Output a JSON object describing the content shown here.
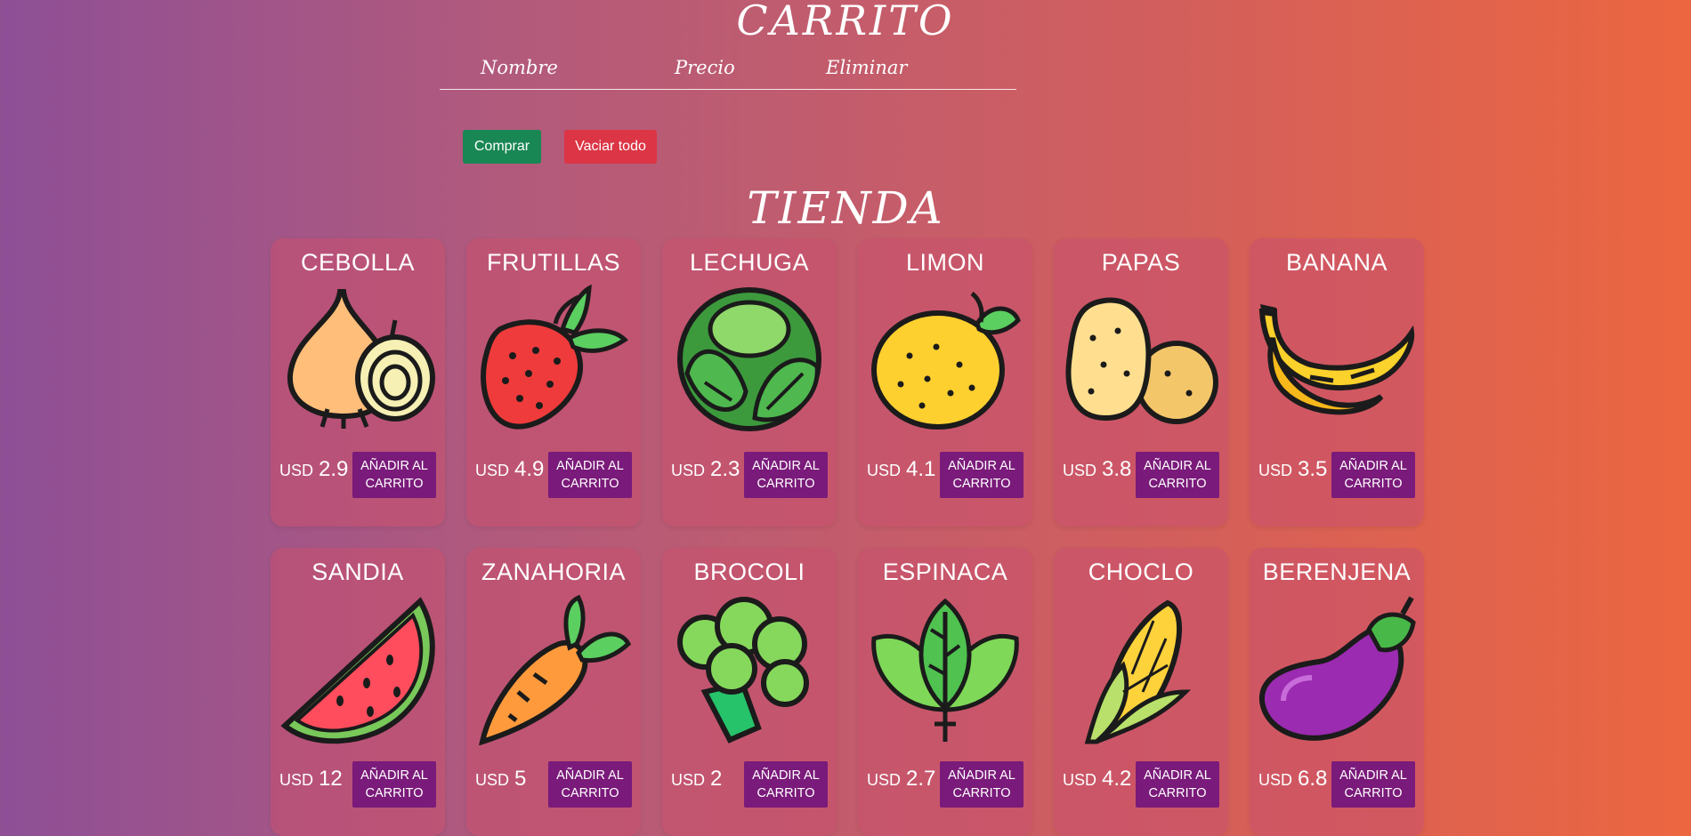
{
  "cart": {
    "title": "CARRITO",
    "columns": {
      "name": "Nombre",
      "price": "Precio",
      "remove": "Eliminar"
    },
    "buy_label": "Comprar",
    "clear_label": "Vaciar todo"
  },
  "shop": {
    "title": "TIENDA",
    "currency": "USD",
    "add_label": "AÑADIR AL CARRITO",
    "products": [
      {
        "name": "CEBOLLA",
        "price": "2.9",
        "icon": "onion-icon"
      },
      {
        "name": "FRUTILLAS",
        "price": "4.9",
        "icon": "strawberry-icon"
      },
      {
        "name": "LECHUGA",
        "price": "2.3",
        "icon": "lettuce-icon"
      },
      {
        "name": "LIMON",
        "price": "4.1",
        "icon": "lemon-icon"
      },
      {
        "name": "PAPAS",
        "price": "3.8",
        "icon": "potato-icon"
      },
      {
        "name": "BANANA",
        "price": "3.5",
        "icon": "banana-icon"
      },
      {
        "name": "SANDIA",
        "price": "12",
        "icon": "watermelon-icon"
      },
      {
        "name": "ZANAHORIA",
        "price": "5",
        "icon": "carrot-icon"
      },
      {
        "name": "BROCOLI",
        "price": "2",
        "icon": "broccoli-icon"
      },
      {
        "name": "ESPINACA",
        "price": "2.7",
        "icon": "spinach-icon"
      },
      {
        "name": "CHOCLO",
        "price": "4.2",
        "icon": "corn-icon"
      },
      {
        "name": "BERENJENA",
        "price": "6.8",
        "icon": "eggplant-icon"
      }
    ]
  }
}
